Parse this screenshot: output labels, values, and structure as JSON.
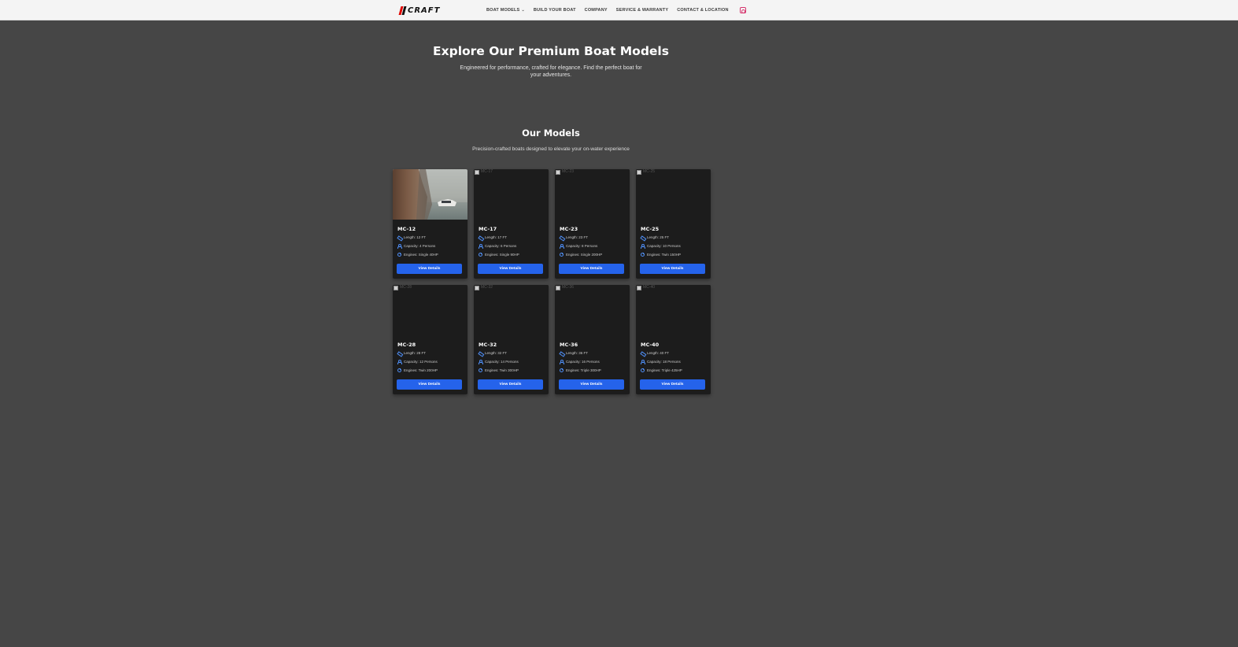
{
  "nav": {
    "logo_text": "CRAFT",
    "items": [
      {
        "label": "BOAT MODELS",
        "has_dropdown": true
      },
      {
        "label": "BUILD YOUR BOAT"
      },
      {
        "label": "COMPANY"
      },
      {
        "label": "SERVICE & WARRANTY"
      },
      {
        "label": "CONTACT & LOCATION"
      }
    ],
    "social_icon": "instagram-icon",
    "accent_color": "#d6336c"
  },
  "hero": {
    "title": "Explore Our Premium Boat Models",
    "subtitle": "Engineered for performance, crafted for elegance. Find the perfect boat for your adventures."
  },
  "models_section": {
    "title": "Our Models",
    "subtitle": "Precision-crafted boats designed to elevate your on-water experience"
  },
  "button_color": "#2563eb",
  "models": [
    {
      "name": "MC-12",
      "length": "Length: 12 FT",
      "capacity": "Capacity: 4 Persons",
      "engine": "Engines: Single 40HP",
      "button": "View Details",
      "image": "photo",
      "alt": ""
    },
    {
      "name": "MC-17",
      "length": "Length: 17 FT",
      "capacity": "Capacity: 6 Persons",
      "engine": "Engines: Single 90HP",
      "button": "View Details",
      "image": "broken",
      "alt": "MC-17"
    },
    {
      "name": "MC-23",
      "length": "Length: 23 FT",
      "capacity": "Capacity: 8 Persons",
      "engine": "Engines: Single 200HP",
      "button": "View Details",
      "image": "broken",
      "alt": "MC-23"
    },
    {
      "name": "MC-25",
      "length": "Length: 25 FT",
      "capacity": "Capacity: 10 Persons",
      "engine": "Engines: Twin 150HP",
      "button": "View Details",
      "image": "broken",
      "alt": "MC-25"
    },
    {
      "name": "MC-28",
      "length": "Length: 28 FT",
      "capacity": "Capacity: 12 Persons",
      "engine": "Engines: Twin 200HP",
      "button": "View Details",
      "image": "broken",
      "alt": "MC-28"
    },
    {
      "name": "MC-32",
      "length": "Length: 32 FT",
      "capacity": "Capacity: 14 Persons",
      "engine": "Engines: Twin 300HP",
      "button": "View Details",
      "image": "broken",
      "alt": "MC-32"
    },
    {
      "name": "MC-36",
      "length": "Length: 36 FT",
      "capacity": "Capacity: 16 Persons",
      "engine": "Engines: Triple 300HP",
      "button": "View Details",
      "image": "broken",
      "alt": "MC-36"
    },
    {
      "name": "MC-40",
      "length": "Length: 40 FT",
      "capacity": "Capacity: 18 Persons",
      "engine": "Engines: Triple 425HP",
      "button": "View Details",
      "image": "broken",
      "alt": "MC-40"
    }
  ]
}
